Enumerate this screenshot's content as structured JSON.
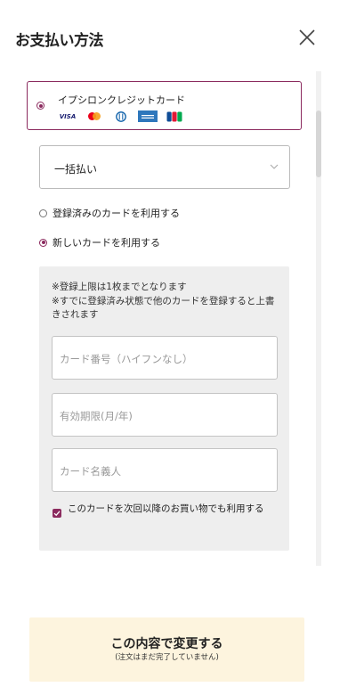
{
  "header": {
    "title": "お支払い方法"
  },
  "payment_method": {
    "label": "イプシロンクレジットカード",
    "brands": [
      "VISA",
      "Mastercard",
      "Diners",
      "AMEX",
      "JCB"
    ]
  },
  "installment": {
    "selected": "一括払い"
  },
  "card_options": {
    "existing_label": "登録済みのカードを利用する",
    "new_label": "新しいカードを利用する"
  },
  "new_card": {
    "note_line1": "※登録上限は1枚までとなります",
    "note_line2": "※すでに登録済み状態で他のカードを登録すると上書きされます",
    "card_number_placeholder": "カード番号（ハイフンなし）",
    "expiry_placeholder": "有効期限(月/年)",
    "holder_placeholder": "カード名義人",
    "save_label": "このカードを次回以降のお買い物でも利用する"
  },
  "submit": {
    "label": "この内容で変更する",
    "sublabel": "(注文はまだ完了していません)"
  },
  "colors": {
    "accent": "#8b2a5e",
    "submit_bg": "#fdf4de",
    "panel_bg": "#eeeeee"
  }
}
